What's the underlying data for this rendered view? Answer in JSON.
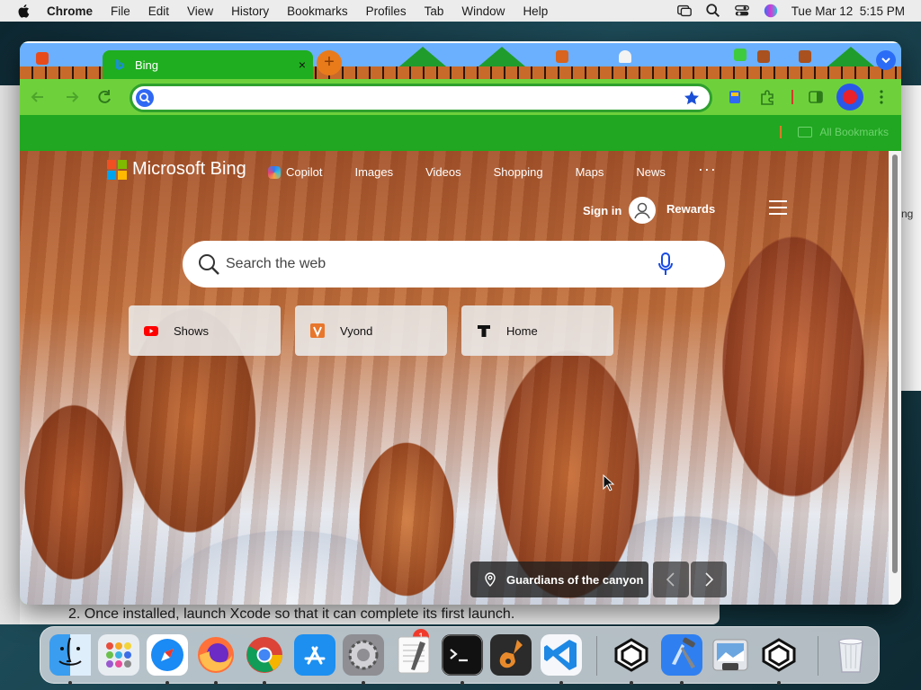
{
  "menubar": {
    "app_name": "Chrome",
    "menus": [
      "File",
      "Edit",
      "View",
      "History",
      "Bookmarks",
      "Profiles",
      "Tab",
      "Window",
      "Help"
    ],
    "datetime": "Tue Mar 12  5:15 PM"
  },
  "background": {
    "step_text": "2.  Once installed, launch Xcode so that it can complete its first launch.",
    "right_window_fragment": "ng"
  },
  "browser": {
    "tab_title": "Bing",
    "tab_close": "×",
    "new_tab": "+",
    "omnibox_value": "",
    "bookmarks_label": "All Bookmarks"
  },
  "bing": {
    "logo_text": "Microsoft Bing",
    "nav": [
      "Copilot",
      "Images",
      "Videos",
      "Shopping",
      "Maps",
      "News"
    ],
    "more": "···",
    "sign_in": "Sign in",
    "rewards": "Rewards",
    "search_placeholder": "Search the web",
    "tiles": [
      {
        "label": "Shows",
        "icon": "youtube-icon",
        "color": "#ff0000"
      },
      {
        "label": "Vyond",
        "icon": "vyond-icon",
        "color": "#e8762b"
      },
      {
        "label": "Home",
        "icon": "t-icon",
        "color": "#111111"
      }
    ],
    "caption": "Guardians of the canyon"
  },
  "dock": {
    "apps": [
      "finder-icon",
      "launchpad-icon",
      "safari-icon",
      "firefox-icon",
      "chrome-icon",
      "app-store-icon",
      "system-settings-icon",
      "textedit-icon",
      "terminal-icon",
      "garageband-icon",
      "vscode-icon",
      "unity-icon",
      "xcode-icon",
      "preview-icon",
      "unity-hub-icon",
      "trash-icon"
    ],
    "settings_badge": "1"
  },
  "colors": {
    "tab_green": "#1fae1f",
    "toolbar_green": "#6ed13c",
    "bookmark_bar_green": "#21a721",
    "accent_blue": "#2f68f3"
  }
}
